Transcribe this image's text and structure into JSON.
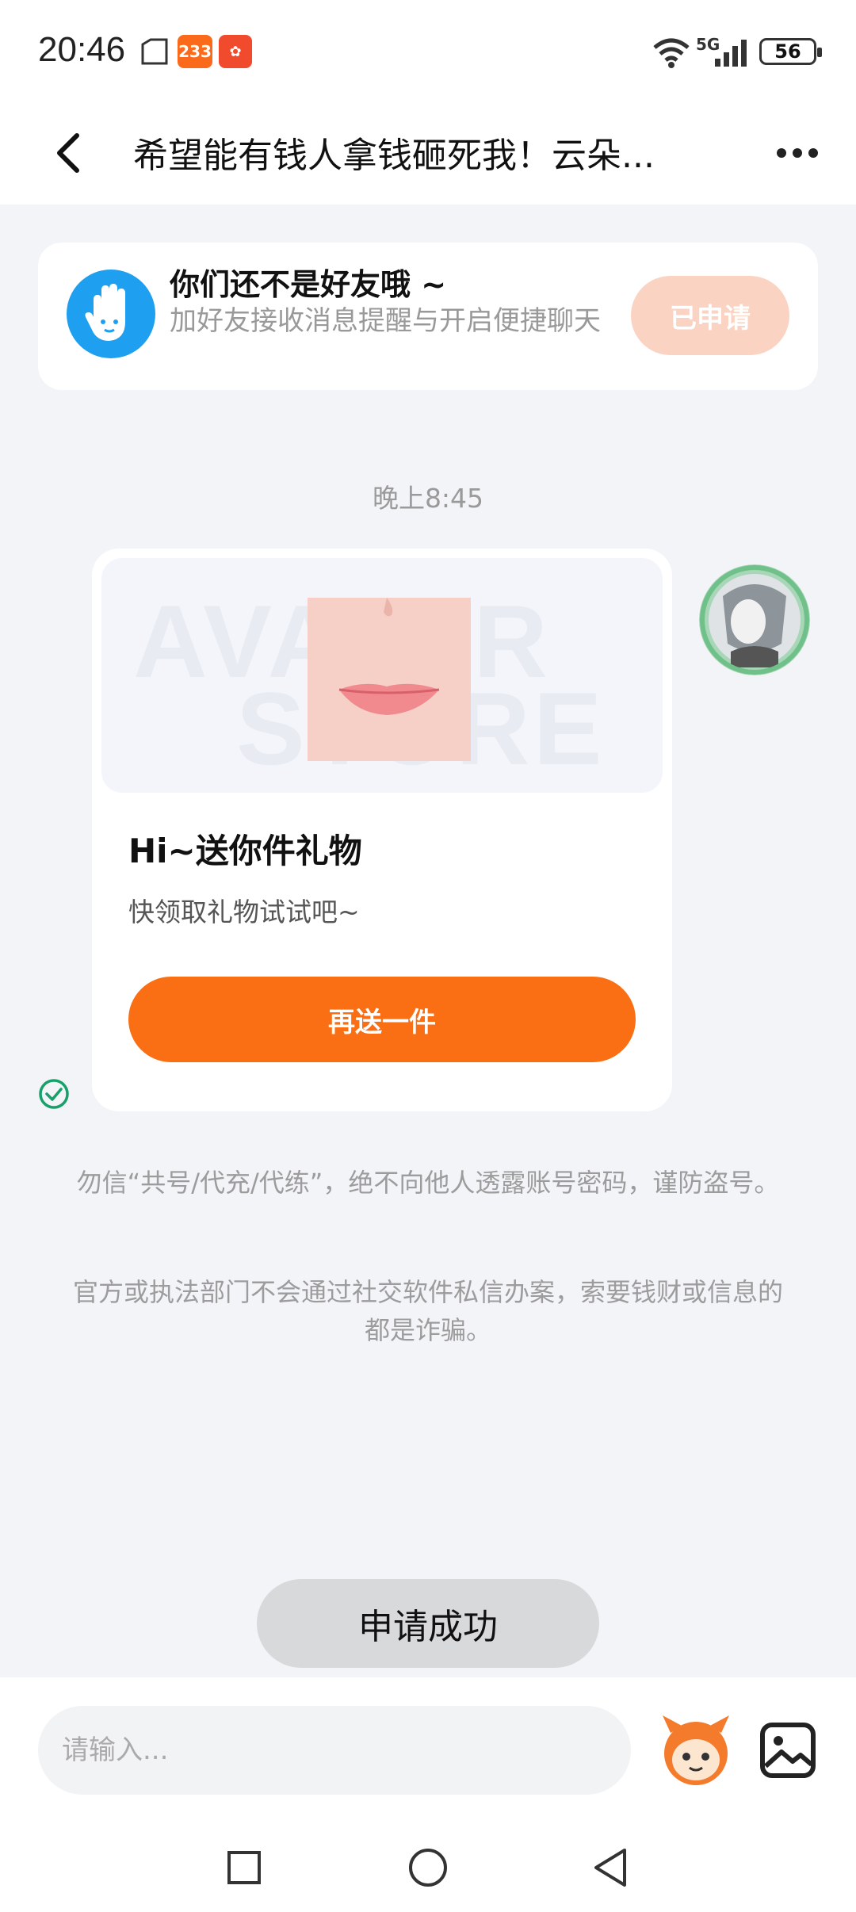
{
  "status_bar": {
    "time": "20:46",
    "app_badge_1": "233",
    "battery": "56",
    "network": "5G"
  },
  "header": {
    "title": "希望能有钱人拿钱砸死我！云朵..."
  },
  "friend_banner": {
    "title": "你们还不是好友哦 ~",
    "subtitle": "加好友接收消息提醒与开启便捷聊天",
    "button_label": "已申请"
  },
  "chat": {
    "timestamp": "晚上8:45",
    "gift_card": {
      "watermark_line1": "AVATAR",
      "watermark_line2": "STORE",
      "title": "Hi~送你件礼物",
      "subtitle": "快领取礼物试试吧~",
      "button_label": "再送一件"
    }
  },
  "warnings": [
    "勿信“共号/代充/代练”，绝不向他人透露账号密码，谨防盗号。",
    "官方或执法部门不会通过社交软件私信办案，索要钱财或信息的都是诈骗。"
  ],
  "toast": "申请成功",
  "input": {
    "placeholder": "请输入..."
  },
  "colors": {
    "accent": "#fa6e14",
    "applied": "#fbd3c2",
    "banner_icon": "#1f9ff0"
  }
}
